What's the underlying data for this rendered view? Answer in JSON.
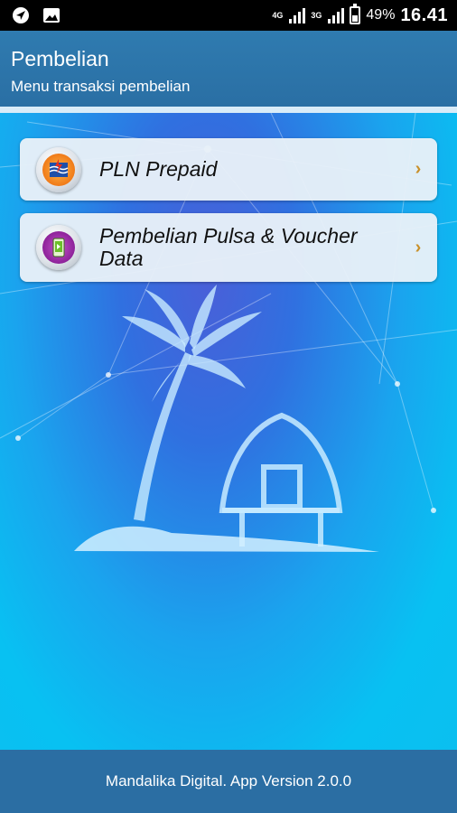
{
  "status_bar": {
    "left_icons": [
      "navigation-icon",
      "image-icon"
    ],
    "network_1": "4G",
    "network_2": "3G",
    "battery_percent": "49%",
    "battery_level": 0.49,
    "time": "16.41"
  },
  "header": {
    "title": "Pembelian",
    "subtitle": "Menu transaksi pembelian"
  },
  "menu": {
    "items": [
      {
        "label": "PLN Prepaid",
        "icon": "pln-logo-icon",
        "arrow": "›"
      },
      {
        "label": "Pembelian Pulsa & Voucher Data",
        "icon": "phone-voucher-icon",
        "arrow": "›"
      }
    ]
  },
  "footer": {
    "text": "Mandalika Digital. App Version 2.0.0"
  },
  "colors": {
    "header_bg": "#2f7bb0",
    "footer_bg": "#2b6ea3",
    "arrow": "#c8902a",
    "background": "#0aa8df"
  }
}
